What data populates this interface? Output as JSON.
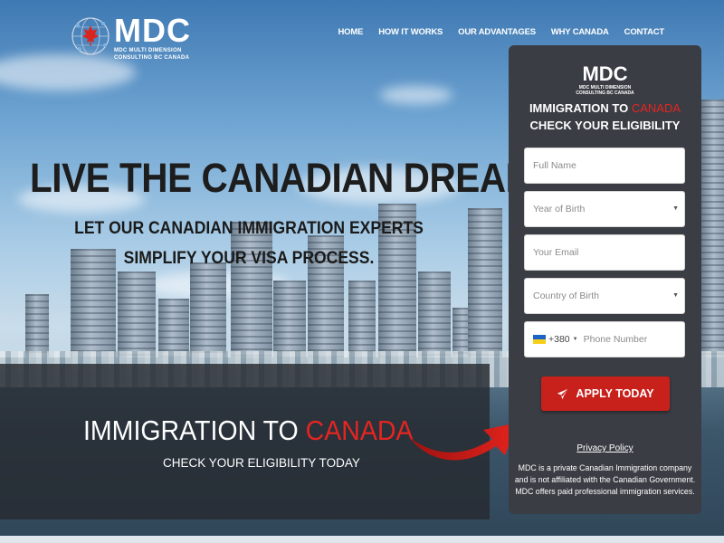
{
  "brand": {
    "logo_text": "MDC",
    "logo_subtitle": "MDC MULTI DIMENSION CONSULTING BC CANADA"
  },
  "nav": {
    "items": [
      {
        "label": "HOME"
      },
      {
        "label": "HOW IT WORKS"
      },
      {
        "label": "OUR ADVANTAGES"
      },
      {
        "label": "WHY CANADA"
      },
      {
        "label": "CONTACT"
      }
    ]
  },
  "hero": {
    "title": "LIVE THE CANADIAN DREAM",
    "subtitle_line1": "LET OUR CANADIAN IMMIGRATION EXPERTS",
    "subtitle_line2": "SIMPLIFY YOUR VISA PROCESS."
  },
  "cta_box": {
    "title_part1": "IMMIGRATION TO",
    "title_part2": "CANADA",
    "subtitle": "CHECK YOUR ELIGIBILITY TODAY"
  },
  "form": {
    "logo_text": "MDC",
    "logo_subtitle_line1": "MDC MULTI DIMENSION",
    "logo_subtitle_line2": "CONSULTING BC CANADA",
    "title_part1": "IMMIGRATION TO",
    "title_part2": "CANADA",
    "title_line2": "CHECK YOUR ELIGIBILITY",
    "full_name_placeholder": "Full Name",
    "year_of_birth_placeholder": "Year of Birth",
    "email_placeholder": "Your Email",
    "country_of_birth_placeholder": "Country of Birth",
    "phone_code": "+380",
    "phone_placeholder": "Phone Number",
    "apply_label": "APPLY TODAY",
    "privacy_label": "Privacy Policy",
    "disclaimer": "MDC is a private Canadian Immigration company and is not affiliated with the Canadian Government. MDC offers paid professional immigration services."
  },
  "colors": {
    "accent_red": "#e52521",
    "button_red": "#c8201b",
    "panel_bg": "#3a3d44",
    "dark_box_bg": "#262a30"
  },
  "icons": {
    "logo": "globe-maple-leaf-icon",
    "apply": "paper-plane-icon",
    "phone_flag": "ukraine-flag-icon",
    "arrow": "curved-arrow-icon"
  }
}
